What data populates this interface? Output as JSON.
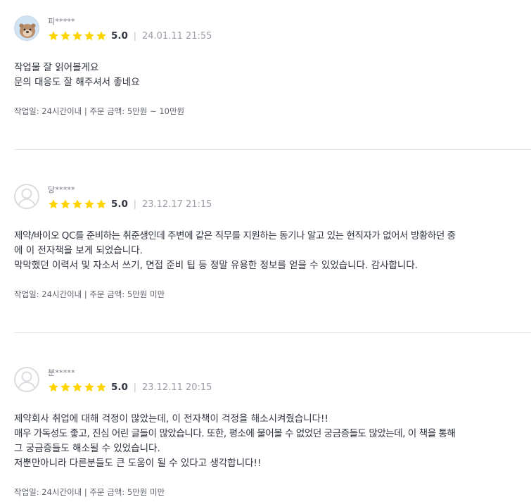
{
  "reviews": [
    {
      "nickname": "피*****",
      "score": "5.0",
      "separator": "|",
      "date": "24.01.11 21:55",
      "lines": [
        "작업물 잘 읽어볼게요",
        "문의 대응도 잘 해주셔서 좋네요"
      ],
      "meta": "작업일: 24시간이내 | 주문 금액: 5만원 ~ 10만원",
      "rating_stars": 5,
      "avatar": "photo"
    },
    {
      "nickname": "당*****",
      "score": "5.0",
      "separator": "|",
      "date": "23.12.17 21:15",
      "lines": [
        "제약/바이오 QC를 준비하는 취준생인데 주변에 같은 직무를 지원하는 동기나 알고 있는 현직자가 없어서 방황하던 중",
        "에 이 전자책을 보게 되었습니다.",
        "막막했던 이력서 및 자소서 쓰기, 면접 준비 팁 등 정말 유용한 정보를 얻을 수 있었습니다. 감사합니다."
      ],
      "meta": "작업일: 24시간이내 | 주문 금액: 5만원 미만",
      "rating_stars": 5,
      "avatar": "default"
    },
    {
      "nickname": "분*****",
      "score": "5.0",
      "separator": "|",
      "date": "23.12.11 20:15",
      "lines": [
        "제약회사 취업에 대해 걱정이 많았는데, 이 전자책이 걱정을 해소시켜줬습니다!!",
        "매우 가독성도 좋고, 진심 어린 글들이 많았습니다. 또한, 평소에 물어볼 수 없었던 궁금증들도 많았는데, 이 책을 통해",
        "그 궁금증들도 해소될 수 있었습니다.",
        "저뿐만아니라 다른분들도 큰 도움이 될 수 있다고 생각합니다!!"
      ],
      "meta": "작업일: 24시간이내 | 주문 금액: 5만원 미만",
      "rating_stars": 5,
      "avatar": "default"
    }
  ],
  "colors": {
    "star": "#ffd400",
    "text": "#303441",
    "muted": "#9a9ea8",
    "divider": "#e4e5ed"
  },
  "icons": {
    "star": "star-icon",
    "avatar_photo": "otter-avatar-icon",
    "avatar_default": "default-user-icon"
  }
}
